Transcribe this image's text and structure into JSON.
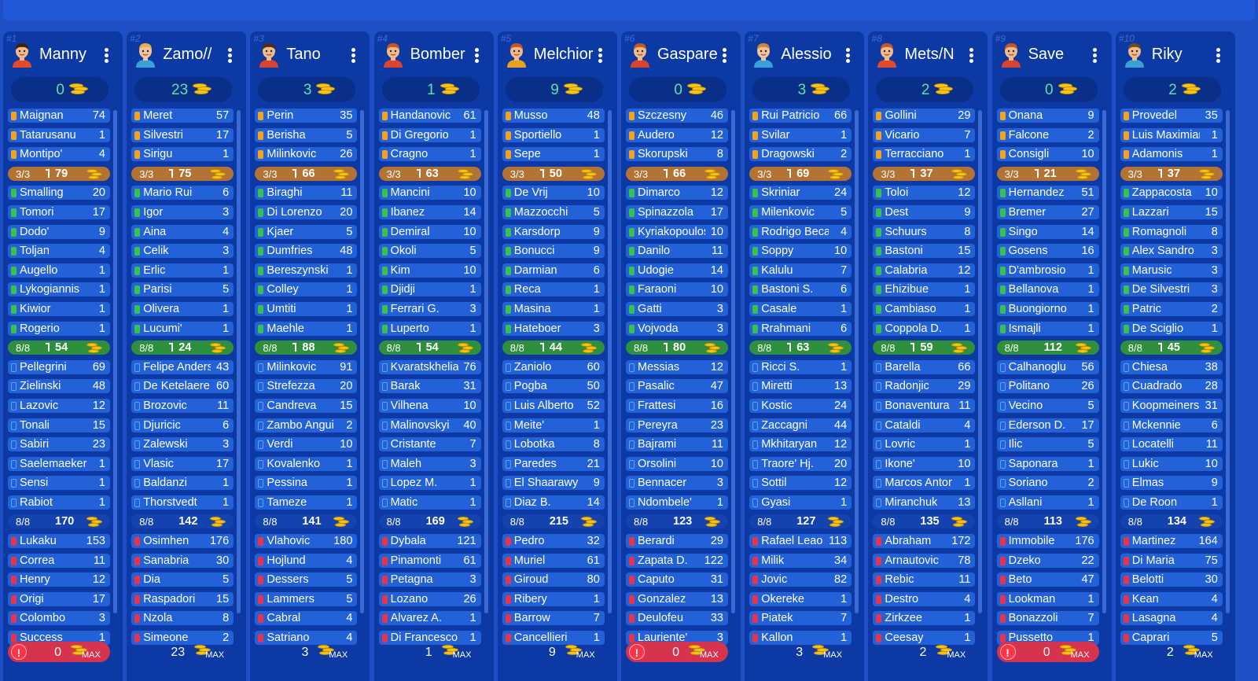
{
  "summary_counts": {
    "gk": "3/3",
    "def": "8/8",
    "mid": "8/8"
  },
  "max_label": "MAX",
  "colors": {
    "gk": "#f7a21b",
    "def": "#39c24b",
    "mid": "#5aa6ff",
    "att": "#e8334b",
    "budget": "#5fe2a8"
  },
  "teams": [
    {
      "num": "#1",
      "name": "Manny",
      "budget": "0",
      "footer": "0",
      "alert": true,
      "gk": [
        [
          "Maignan",
          "74"
        ],
        [
          "Tatarusanu",
          "1"
        ],
        [
          "Montipo'",
          "4"
        ]
      ],
      "gk_total": "79",
      "def": [
        [
          "Smalling",
          "20"
        ],
        [
          "Tomori",
          "17"
        ],
        [
          "Dodo'",
          "9"
        ],
        [
          "Toljan",
          "4"
        ],
        [
          "Augello",
          "1"
        ],
        [
          "Lykogiannis",
          "1"
        ],
        [
          "Kiwior",
          "1"
        ],
        [
          "Rogerio",
          "1"
        ]
      ],
      "def_total": "54",
      "mid": [
        [
          "Pellegrini",
          "69"
        ],
        [
          "Zielinski",
          "48"
        ],
        [
          "Lazovic",
          "12"
        ],
        [
          "Tonali",
          "15"
        ],
        [
          "Sabiri",
          "23"
        ],
        [
          "Saelemaekers",
          "1"
        ],
        [
          "Sensi",
          "1"
        ],
        [
          "Rabiot",
          "1"
        ]
      ],
      "mid_total": "170",
      "att": [
        [
          "Lukaku",
          "153"
        ],
        [
          "Correa",
          "11"
        ],
        [
          "Henry",
          "12"
        ],
        [
          "Origi",
          "17"
        ],
        [
          "Colombo",
          "3"
        ],
        [
          "Success",
          "1"
        ]
      ]
    },
    {
      "num": "#2",
      "name": "Zamo//",
      "budget": "23",
      "footer": "23",
      "alert": false,
      "gk": [
        [
          "Meret",
          "57"
        ],
        [
          "Silvestri",
          "17"
        ],
        [
          "Sirigu",
          "1"
        ]
      ],
      "gk_total": "75",
      "def": [
        [
          "Mario Rui",
          "6"
        ],
        [
          "Igor",
          "3"
        ],
        [
          "Aina",
          "4"
        ],
        [
          "Celik",
          "3"
        ],
        [
          "Erlic",
          "1"
        ],
        [
          "Parisi",
          "5"
        ],
        [
          "Olivera",
          "1"
        ],
        [
          "Lucumi'",
          "1"
        ]
      ],
      "def_total": "24",
      "mid": [
        [
          "Felipe Anderson",
          "43"
        ],
        [
          "De Ketelaere",
          "60"
        ],
        [
          "Brozovic",
          "11"
        ],
        [
          "Djuricic",
          "6"
        ],
        [
          "Zalewski",
          "3"
        ],
        [
          "Vlasic",
          "17"
        ],
        [
          "Baldanzi",
          "1"
        ],
        [
          "Thorstvedt",
          "1"
        ]
      ],
      "mid_total": "142",
      "att": [
        [
          "Osimhen",
          "176"
        ],
        [
          "Sanabria",
          "30"
        ],
        [
          "Dia",
          "5"
        ],
        [
          "Raspadori",
          "15"
        ],
        [
          "Nzola",
          "8"
        ],
        [
          "Simeone",
          "2"
        ]
      ]
    },
    {
      "num": "#3",
      "name": "Tano",
      "budget": "3",
      "footer": "3",
      "alert": false,
      "gk": [
        [
          "Perin",
          "35"
        ],
        [
          "Berisha",
          "5"
        ],
        [
          "Milinkovic",
          "26"
        ]
      ],
      "gk_total": "66",
      "def": [
        [
          "Biraghi",
          "11"
        ],
        [
          "Di Lorenzo",
          "20"
        ],
        [
          "Kjaer",
          "5"
        ],
        [
          "Dumfries",
          "48"
        ],
        [
          "Bereszynski",
          "1"
        ],
        [
          "Colley",
          "1"
        ],
        [
          "Umtiti",
          "1"
        ],
        [
          "Maehle",
          "1"
        ]
      ],
      "def_total": "88",
      "mid": [
        [
          "Milinkovic",
          "91"
        ],
        [
          "Strefezza",
          "20"
        ],
        [
          "Candreva",
          "15"
        ],
        [
          "Zambo Anguissa",
          "2"
        ],
        [
          "Verdi",
          "10"
        ],
        [
          "Kovalenko",
          "1"
        ],
        [
          "Pessina",
          "1"
        ],
        [
          "Tameze",
          "1"
        ]
      ],
      "mid_total": "141",
      "att": [
        [
          "Vlahovic",
          "180"
        ],
        [
          "Hojlund",
          "4"
        ],
        [
          "Dessers",
          "5"
        ],
        [
          "Lammers",
          "5"
        ],
        [
          "Cabral",
          "4"
        ],
        [
          "Satriano",
          "4"
        ]
      ]
    },
    {
      "num": "#4",
      "name": "Bomber",
      "budget": "1",
      "footer": "1",
      "alert": false,
      "gk": [
        [
          "Handanovic",
          "61"
        ],
        [
          "Di Gregorio",
          "1"
        ],
        [
          "Cragno",
          "1"
        ]
      ],
      "gk_total": "63",
      "def": [
        [
          "Mancini",
          "10"
        ],
        [
          "Ibanez",
          "14"
        ],
        [
          "Demiral",
          "10"
        ],
        [
          "Okoli",
          "5"
        ],
        [
          "Kim",
          "10"
        ],
        [
          "Djidji",
          "1"
        ],
        [
          "Ferrari G.",
          "3"
        ],
        [
          "Luperto",
          "1"
        ]
      ],
      "def_total": "54",
      "mid": [
        [
          "Kvaratskhelia",
          "76"
        ],
        [
          "Barak",
          "31"
        ],
        [
          "Vilhena",
          "10"
        ],
        [
          "Malinovskyi",
          "40"
        ],
        [
          "Cristante",
          "7"
        ],
        [
          "Maleh",
          "3"
        ],
        [
          "Lopez M.",
          "1"
        ],
        [
          "Matic",
          "1"
        ]
      ],
      "mid_total": "169",
      "att": [
        [
          "Dybala",
          "121"
        ],
        [
          "Pinamonti",
          "61"
        ],
        [
          "Petagna",
          "3"
        ],
        [
          "Lozano",
          "26"
        ],
        [
          "Alvarez A.",
          "1"
        ],
        [
          "Di Francesco",
          "1"
        ]
      ]
    },
    {
      "num": "#5",
      "name": "Melchior",
      "budget": "9",
      "footer": "9",
      "alert": false,
      "gk": [
        [
          "Musso",
          "48"
        ],
        [
          "Sportiello",
          "1"
        ],
        [
          "Sepe",
          "1"
        ]
      ],
      "gk_total": "50",
      "def": [
        [
          "De Vrij",
          "10"
        ],
        [
          "Mazzocchi",
          "5"
        ],
        [
          "Karsdorp",
          "9"
        ],
        [
          "Bonucci",
          "9"
        ],
        [
          "Darmian",
          "6"
        ],
        [
          "Reca",
          "1"
        ],
        [
          "Masina",
          "1"
        ],
        [
          "Hateboer",
          "3"
        ]
      ],
      "def_total": "44",
      "mid": [
        [
          "Zaniolo",
          "60"
        ],
        [
          "Pogba",
          "50"
        ],
        [
          "Luis Alberto",
          "52"
        ],
        [
          "Meite'",
          "1"
        ],
        [
          "Lobotka",
          "8"
        ],
        [
          "Paredes",
          "21"
        ],
        [
          "El Shaarawy",
          "9"
        ],
        [
          "Diaz B.",
          "14"
        ]
      ],
      "mid_total": "215",
      "att": [
        [
          "Pedro",
          "32"
        ],
        [
          "Muriel",
          "61"
        ],
        [
          "Giroud",
          "80"
        ],
        [
          "Ribery",
          "1"
        ],
        [
          "Barrow",
          "7"
        ],
        [
          "Cancellieri",
          "1"
        ]
      ]
    },
    {
      "num": "#6",
      "name": "Gaspare",
      "budget": "0",
      "footer": "0",
      "alert": true,
      "gk": [
        [
          "Szczesny",
          "46"
        ],
        [
          "Audero",
          "12"
        ],
        [
          "Skorupski",
          "8"
        ]
      ],
      "gk_total": "66",
      "def": [
        [
          "Dimarco",
          "12"
        ],
        [
          "Spinazzola",
          "17"
        ],
        [
          "Kyriakopoulos",
          "10"
        ],
        [
          "Danilo",
          "11"
        ],
        [
          "Udogie",
          "14"
        ],
        [
          "Faraoni",
          "10"
        ],
        [
          "Gatti",
          "3"
        ],
        [
          "Vojvoda",
          "3"
        ]
      ],
      "def_total": "80",
      "mid": [
        [
          "Messias",
          "12"
        ],
        [
          "Pasalic",
          "47"
        ],
        [
          "Frattesi",
          "16"
        ],
        [
          "Pereyra",
          "23"
        ],
        [
          "Bajrami",
          "11"
        ],
        [
          "Orsolini",
          "10"
        ],
        [
          "Bennacer",
          "3"
        ],
        [
          "Ndombele'",
          "1"
        ]
      ],
      "mid_total": "123",
      "att": [
        [
          "Berardi",
          "29"
        ],
        [
          "Zapata D.",
          "122"
        ],
        [
          "Caputo",
          "31"
        ],
        [
          "Gonzalez",
          "13"
        ],
        [
          "Deulofeu",
          "33"
        ],
        [
          "Lauriente'",
          "3"
        ]
      ]
    },
    {
      "num": "#7",
      "name": "Alessio",
      "budget": "3",
      "footer": "3",
      "alert": false,
      "gk": [
        [
          "Rui Patricio",
          "66"
        ],
        [
          "Svilar",
          "1"
        ],
        [
          "Dragowski",
          "2"
        ]
      ],
      "gk_total": "69",
      "def": [
        [
          "Skriniar",
          "24"
        ],
        [
          "Milenkovic",
          "5"
        ],
        [
          "Rodrigo Becao",
          "4"
        ],
        [
          "Soppy",
          "10"
        ],
        [
          "Kalulu",
          "7"
        ],
        [
          "Bastoni S.",
          "6"
        ],
        [
          "Casale",
          "1"
        ],
        [
          "Rrahmani",
          "6"
        ]
      ],
      "def_total": "63",
      "mid": [
        [
          "Ricci S.",
          "1"
        ],
        [
          "Miretti",
          "13"
        ],
        [
          "Kostic",
          "24"
        ],
        [
          "Zaccagni",
          "44"
        ],
        [
          "Mkhitaryan",
          "12"
        ],
        [
          "Traore' Hj.",
          "20"
        ],
        [
          "Sottil",
          "12"
        ],
        [
          "Gyasi",
          "1"
        ]
      ],
      "mid_total": "127",
      "att": [
        [
          "Rafael Leao",
          "113"
        ],
        [
          "Milik",
          "34"
        ],
        [
          "Jovic",
          "82"
        ],
        [
          "Okereke",
          "1"
        ],
        [
          "Piatek",
          "7"
        ],
        [
          "Kallon",
          "1"
        ]
      ]
    },
    {
      "num": "#8",
      "name": "Mets/N",
      "budget": "2",
      "footer": "2",
      "alert": false,
      "gk": [
        [
          "Gollini",
          "29"
        ],
        [
          "Vicario",
          "7"
        ],
        [
          "Terracciano",
          "1"
        ]
      ],
      "gk_total": "37",
      "def": [
        [
          "Toloi",
          "12"
        ],
        [
          "Dest",
          "9"
        ],
        [
          "Schuurs",
          "8"
        ],
        [
          "Bastoni",
          "15"
        ],
        [
          "Calabria",
          "12"
        ],
        [
          "Ehizibue",
          "1"
        ],
        [
          "Cambiaso",
          "1"
        ],
        [
          "Coppola D.",
          "1"
        ]
      ],
      "def_total": "59",
      "mid": [
        [
          "Barella",
          "66"
        ],
        [
          "Radonjic",
          "29"
        ],
        [
          "Bonaventura",
          "11"
        ],
        [
          "Cataldi",
          "4"
        ],
        [
          "Lovric",
          "1"
        ],
        [
          "Ikone'",
          "10"
        ],
        [
          "Marcos Antonio",
          "1"
        ],
        [
          "Miranchuk",
          "13"
        ]
      ],
      "mid_total": "135",
      "att": [
        [
          "Abraham",
          "172"
        ],
        [
          "Arnautovic",
          "78"
        ],
        [
          "Rebic",
          "11"
        ],
        [
          "Destro",
          "4"
        ],
        [
          "Zirkzee",
          "1"
        ],
        [
          "Ceesay",
          "1"
        ]
      ]
    },
    {
      "num": "#9",
      "name": "Save",
      "budget": "0",
      "footer": "0",
      "alert": true,
      "gk": [
        [
          "Onana",
          "9"
        ],
        [
          "Falcone",
          "2"
        ],
        [
          "Consigli",
          "10"
        ]
      ],
      "gk_total": "21",
      "def": [
        [
          "Hernandez",
          "51"
        ],
        [
          "Bremer",
          "27"
        ],
        [
          "Singo",
          "14"
        ],
        [
          "Gosens",
          "16"
        ],
        [
          "D'ambrosio",
          "1"
        ],
        [
          "Bellanova",
          "1"
        ],
        [
          "Buongiorno",
          "1"
        ],
        [
          "Ismajli",
          "1"
        ]
      ],
      "def_total": "112",
      "mid": [
        [
          "Calhanoglu",
          "56"
        ],
        [
          "Politano",
          "26"
        ],
        [
          "Vecino",
          "5"
        ],
        [
          "Ederson D.",
          "17"
        ],
        [
          "Ilic",
          "5"
        ],
        [
          "Saponara",
          "1"
        ],
        [
          "Soriano",
          "2"
        ],
        [
          "Asllani",
          "1"
        ]
      ],
      "mid_total": "113",
      "att": [
        [
          "Immobile",
          "176"
        ],
        [
          "Dzeko",
          "22"
        ],
        [
          "Beto",
          "47"
        ],
        [
          "Lookman",
          "1"
        ],
        [
          "Bonazzoli",
          "7"
        ],
        [
          "Pussetto",
          "1"
        ]
      ]
    },
    {
      "num": "#10",
      "name": "Riky",
      "budget": "2",
      "footer": "2",
      "alert": false,
      "gk": [
        [
          "Provedel",
          "35"
        ],
        [
          "Luis Maximiano",
          "1"
        ],
        [
          "Adamonis",
          "1"
        ]
      ],
      "gk_total": "37",
      "def": [
        [
          "Zappacosta",
          "10"
        ],
        [
          "Lazzari",
          "15"
        ],
        [
          "Romagnoli",
          "8"
        ],
        [
          "Alex Sandro",
          "3"
        ],
        [
          "Marusic",
          "3"
        ],
        [
          "De Silvestri",
          "3"
        ],
        [
          "Patric",
          "2"
        ],
        [
          "De Sciglio",
          "1"
        ]
      ],
      "def_total": "45",
      "mid": [
        [
          "Chiesa",
          "38"
        ],
        [
          "Cuadrado",
          "28"
        ],
        [
          "Koopmeiners",
          "31"
        ],
        [
          "Mckennie",
          "6"
        ],
        [
          "Locatelli",
          "11"
        ],
        [
          "Lukic",
          "10"
        ],
        [
          "Elmas",
          "9"
        ],
        [
          "De Roon",
          "1"
        ]
      ],
      "mid_total": "134",
      "att": [
        [
          "Martinez",
          "164"
        ],
        [
          "Di Maria",
          "75"
        ],
        [
          "Belotti",
          "30"
        ],
        [
          "Kean",
          "4"
        ],
        [
          "Lasagna",
          "4"
        ],
        [
          "Caprari",
          "5"
        ]
      ]
    }
  ]
}
